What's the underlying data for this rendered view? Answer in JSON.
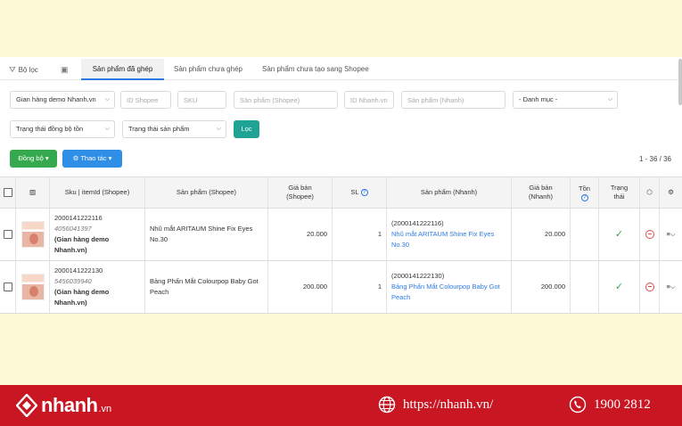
{
  "tabs": [
    {
      "label": "Bộ lọc",
      "icon": "filter-icon"
    },
    {
      "label": "",
      "icon": "save-icon"
    },
    {
      "label": "Sản phẩm đã ghép",
      "active": true
    },
    {
      "label": "Sản phẩm chưa ghép"
    },
    {
      "label": "Sản phẩm chưa tạo sang Shopee"
    }
  ],
  "filters": {
    "store": "Gian hàng demo Nhanh.vn",
    "id_shopee_placeholder": "ID Shopee",
    "sku_placeholder": "SKU",
    "product_shopee_placeholder": "Sản phẩm (Shopee)",
    "id_nhanh_placeholder": "ID Nhanh.vn",
    "product_nhanh_placeholder": "Sản phẩm (Nhanh)",
    "category": "- Danh mục -",
    "sync_status": "Trạng thái đồng bộ tồn",
    "product_status": "Trạng thái sản phẩm",
    "filter_button": "Lọc"
  },
  "actions": {
    "sync_button": "Đồng bộ",
    "operation_button": "Thao tác"
  },
  "pagination": "1 - 36 / 36",
  "table": {
    "headers": {
      "sku": "Sku | itemId (Shopee)",
      "product_shopee": "Sản phẩm (Shopee)",
      "price_shopee_1": "Giá bán",
      "price_shopee_2": "(Shopee)",
      "qty": "SL",
      "product_nhanh": "Sản phẩm (Nhanh)",
      "price_nhanh_1": "Giá bán",
      "price_nhanh_2": "(Nhanh)",
      "stock": "Tồn",
      "status_1": "Trạng",
      "status_2": "thái"
    },
    "rows": [
      {
        "sku": "2000141222116",
        "item_id": "4056041397",
        "store_1": "(Gian hàng demo",
        "store_2": "Nhanh.vn)",
        "product_shopee": "Nhũ mắt ARITAUM Shine Fix Eyes No.30",
        "price_shopee": "20.000",
        "qty": "1",
        "nhanh_code": "(2000141222116)",
        "product_nhanh": "Nhũ mắt ARITAUM Shine Fix Eyes No.30",
        "price_nhanh": "20.000"
      },
      {
        "sku": "2000141222130",
        "item_id": "5456039940",
        "store_1": "(Gian hàng demo",
        "store_2": "Nhanh.vn)",
        "product_shopee": "Bảng Phấn Mắt Colourpop Baby Got Peach",
        "price_shopee": "200.000",
        "qty": "1",
        "nhanh_code": "(2000141222130)",
        "product_nhanh": "Bảng Phấn Mắt Colourpop Baby Got Peach",
        "price_nhanh": "200.000"
      }
    ]
  },
  "footer": {
    "logo_text": "nhanh",
    "logo_suffix": ".vn",
    "website": "https://nhanh.vn/",
    "phone": "1900 2812"
  },
  "colors": {
    "footer_bg": "#c81622",
    "accent": "#2c7be5",
    "filter_button": "#1fa394",
    "sync_button": "#36a94f"
  }
}
